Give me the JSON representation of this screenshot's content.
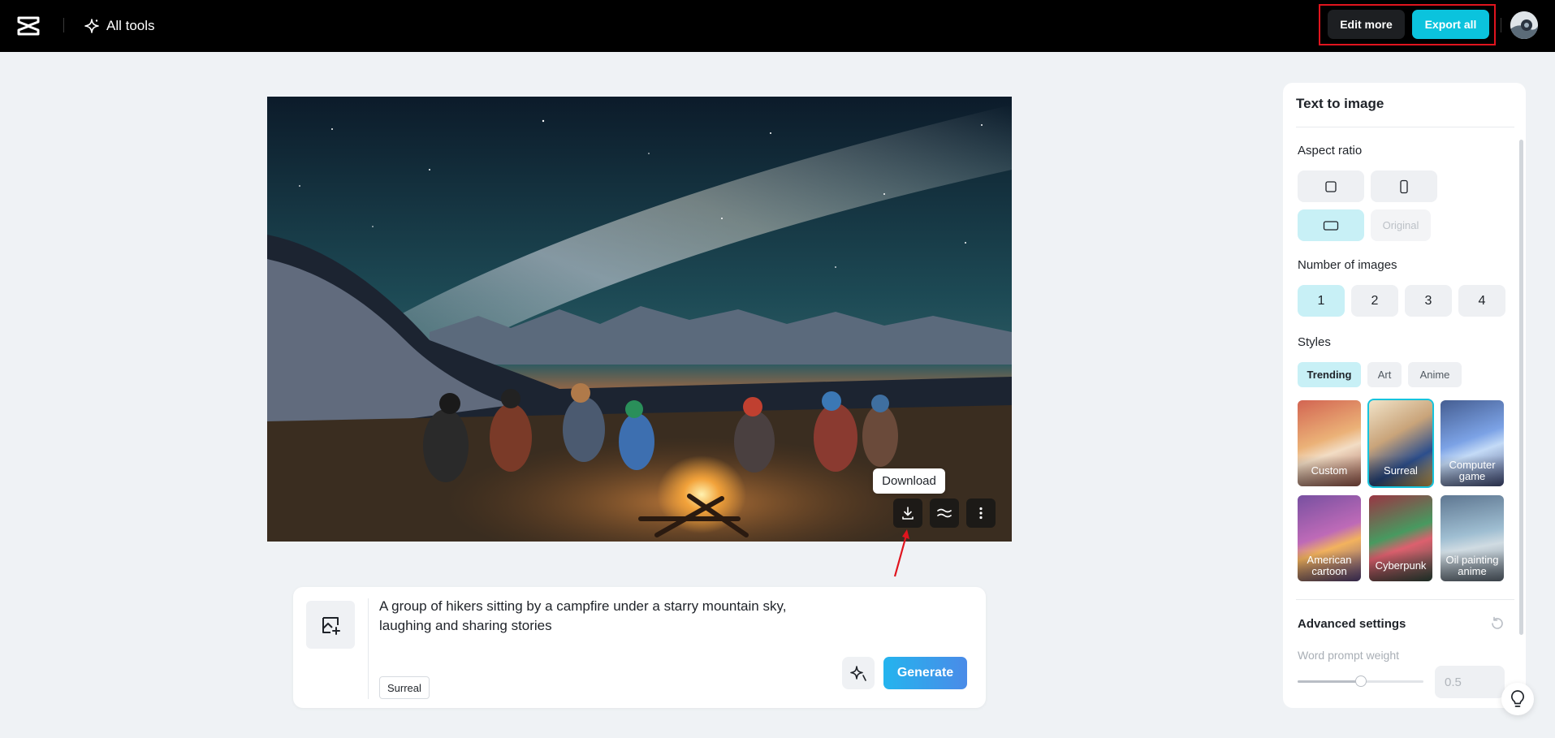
{
  "topbar": {
    "all_tools_label": "All tools",
    "edit_more_label": "Edit more",
    "export_all_label": "Export all"
  },
  "canvas": {
    "tooltip": "Download",
    "icons": [
      "download-icon",
      "variation-icon",
      "more-icon"
    ]
  },
  "prompt": {
    "text": "A group of hikers sitting by a campfire under a starry mountain sky, laughing and sharing stories",
    "style_tag": "Surreal",
    "generate_label": "Generate"
  },
  "panel": {
    "title": "Text to image",
    "aspect_ratio_label": "Aspect ratio",
    "aspect_options": [
      "square",
      "portrait",
      "landscape",
      "Original"
    ],
    "aspect_selected": "landscape",
    "num_images_label": "Number of images",
    "num_images": [
      "1",
      "2",
      "3",
      "4"
    ],
    "num_selected": "1",
    "styles_label": "Styles",
    "style_tabs": [
      "Trending",
      "Art",
      "Anime"
    ],
    "style_tab_selected": "Trending",
    "styles": [
      "Custom",
      "Surreal",
      "Computer game",
      "American cartoon",
      "Cyberpunk",
      "Oil painting anime"
    ],
    "style_selected": "Surreal",
    "advanced_label": "Advanced settings",
    "word_prompt_weight_label": "Word prompt weight",
    "word_prompt_weight_value": "0.5",
    "slider_fraction": 0.5
  },
  "colors": {
    "accent": "#0bc3dd",
    "selected_bg": "#c8f0f6",
    "highlight_box": "#e0141e"
  }
}
